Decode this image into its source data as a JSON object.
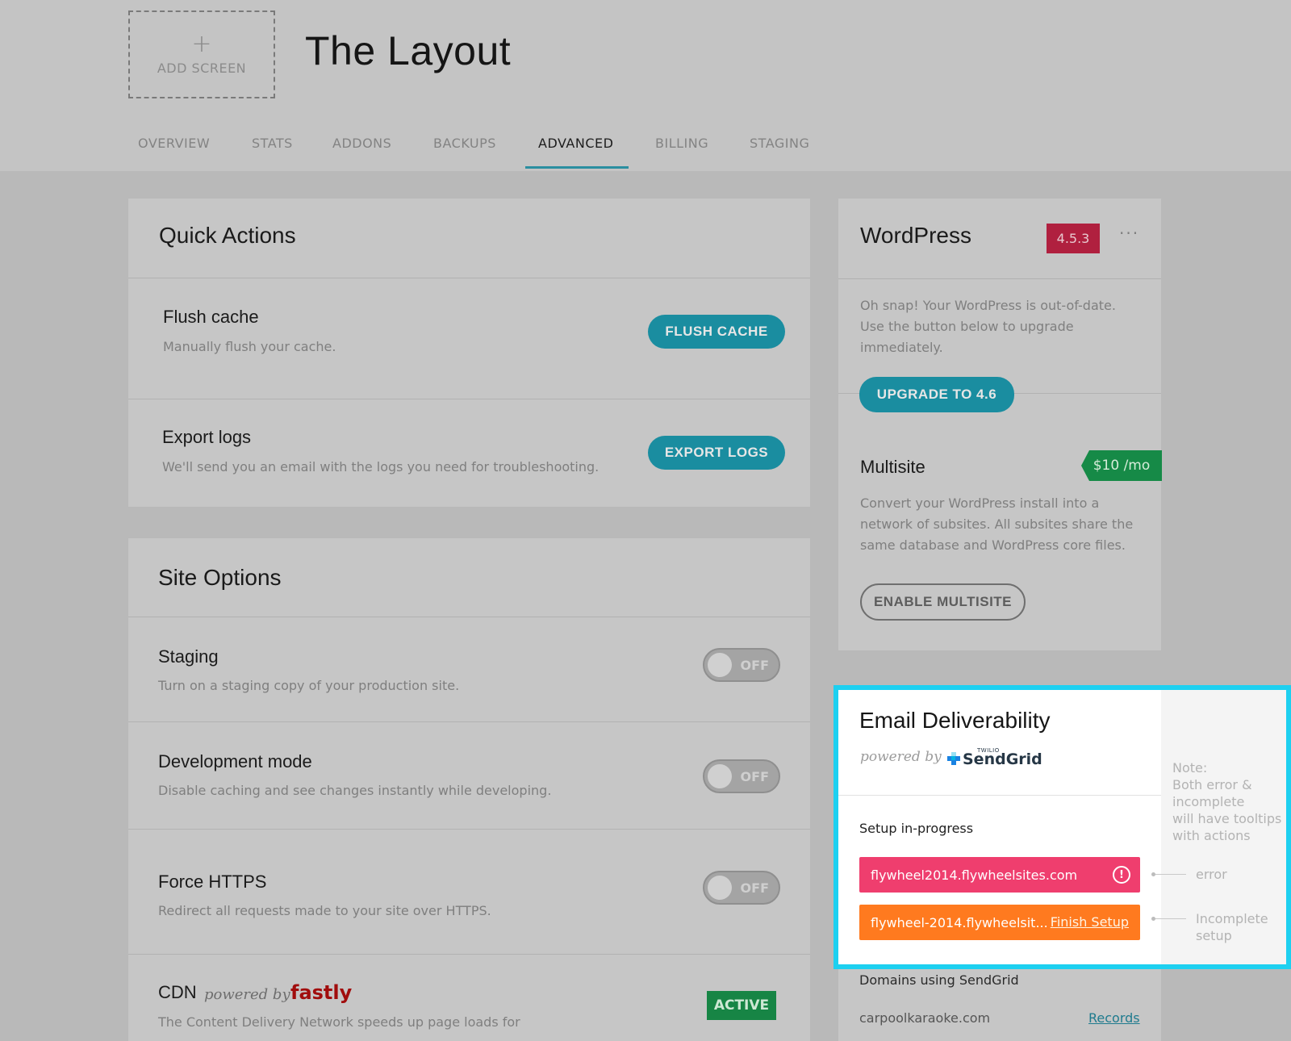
{
  "header": {
    "add_screen_plus": "+",
    "add_screen_label": "ADD SCREEN",
    "title": "The Layout"
  },
  "tabs": [
    {
      "label": "OVERVIEW"
    },
    {
      "label": "STATS"
    },
    {
      "label": "ADDONS"
    },
    {
      "label": "BACKUPS"
    },
    {
      "label": "ADVANCED",
      "active": true
    },
    {
      "label": "BILLING"
    },
    {
      "label": "STAGING"
    }
  ],
  "quick_actions": {
    "title": "Quick Actions",
    "flush": {
      "title": "Flush cache",
      "desc": "Manually flush your cache.",
      "button": "FLUSH CACHE"
    },
    "export": {
      "title": "Export logs",
      "desc": "We'll send you an email with the logs you need for troubleshooting.",
      "button": "EXPORT LOGS"
    }
  },
  "site_options": {
    "title": "Site Options",
    "staging": {
      "title": "Staging",
      "desc": "Turn on a staging copy of your production site.",
      "toggle": "OFF"
    },
    "dev_mode": {
      "title": "Development mode",
      "desc": "Disable caching and see changes instantly while developing.",
      "toggle": "OFF"
    },
    "https": {
      "title": "Force HTTPS",
      "desc": "Redirect all requests made to your site over HTTPS.",
      "toggle": "OFF"
    },
    "cdn": {
      "title": "CDN",
      "powered_by": "powered by",
      "brand": "fastly",
      "desc": "The Content Delivery Network speeds up page loads for",
      "status": "ACTIVE"
    }
  },
  "wordpress": {
    "title": "WordPress",
    "version": "4.5.3",
    "menu": "···",
    "msg_lines": [
      "Oh snap! Your WordPress is out-of-date.",
      "Use the button below to upgrade",
      "immediately."
    ],
    "upgrade_button": "UPGRADE TO 4.6"
  },
  "multisite": {
    "title": "Multisite",
    "price": "$10 /mo",
    "desc_lines": [
      "Convert your WordPress install into a",
      "network of subsites. All subsites share the",
      "same database and WordPress core files."
    ],
    "button": "ENABLE MULTISITE"
  },
  "email": {
    "title": "Email Deliverability",
    "powered_by": "powered by",
    "brand": "SendGrid",
    "brand_super": "TWILIO",
    "status": "Setup in-progress",
    "error_domain": "flywheel2014.flywheelsites.com",
    "error_icon": "!",
    "incomplete_domain": "flywheel-2014.flywheelsit...",
    "finish_setup": "Finish Setup",
    "domains_label": "Domains using SendGrid",
    "domain_row": "carpoolkaraoke.com",
    "records_link": "Records"
  },
  "annotations": {
    "note_lines": [
      "Note:",
      "Both error &",
      "incomplete",
      "will have tooltips",
      "with actions"
    ],
    "error_label": "error",
    "incomplete_lines": [
      "Incomplete",
      "setup"
    ]
  },
  "colors": {
    "accent": "#1a8da0",
    "error": "#ef3e6e",
    "incomplete": "#ff7a1f",
    "version_badge": "#b0203f",
    "active_green": "#178545",
    "highlight": "#1dd0f0"
  }
}
